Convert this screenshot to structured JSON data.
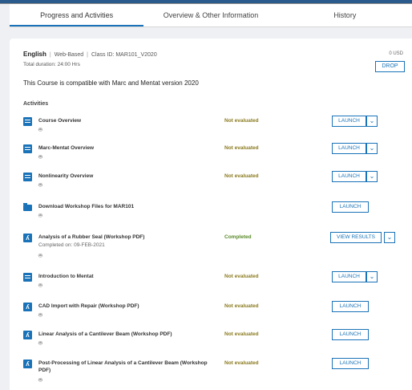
{
  "tabs": [
    {
      "label": "Progress and Activities",
      "active": true
    },
    {
      "label": "Overview & Other Information",
      "active": false
    },
    {
      "label": "History",
      "active": false
    }
  ],
  "course": {
    "language": "English",
    "delivery": "Web-Based",
    "class_id": "Class ID: MAR101_V2020",
    "duration": "Total duration: 24:00 Hrs",
    "price": "0 USD",
    "drop_label": "DROP",
    "compatibility": "This Course is compatible with Marc and Mentat version 2020"
  },
  "activities_heading": "Activities",
  "activities": [
    {
      "title": "Course Overview",
      "icon": "document-icon",
      "status": "Not evaluated",
      "button": "LAUNCH",
      "has_dropdown": true
    },
    {
      "title": "Marc-Mentat Overview",
      "icon": "document-icon",
      "status": "Not evaluated",
      "button": "LAUNCH",
      "has_dropdown": true
    },
    {
      "title": "Nonlinearity Overview",
      "icon": "document-icon",
      "status": "Not evaluated",
      "button": "LAUNCH",
      "has_dropdown": true
    },
    {
      "title": "Download Workshop Files for MAR101",
      "icon": "folder-icon",
      "status": "",
      "button": "LAUNCH",
      "has_dropdown": false
    },
    {
      "title": "Analysis of a Rubber Seal (Workshop PDF)",
      "icon": "pdf-icon",
      "status": "Completed",
      "completed_on": "Completed on: 09-FEB-2021",
      "button": "VIEW RESULTS",
      "has_dropdown": true
    },
    {
      "title": "Introduction to Mentat",
      "icon": "document-icon",
      "status": "Not evaluated",
      "button": "LAUNCH",
      "has_dropdown": true
    },
    {
      "title": "CAD Import with Repair (Workshop PDF)",
      "icon": "pdf-icon",
      "status": "Not evaluated",
      "button": "LAUNCH",
      "has_dropdown": false
    },
    {
      "title": "Linear Analysis of a Cantilever Beam (Workshop PDF)",
      "icon": "pdf-icon",
      "status": "Not evaluated",
      "button": "LAUNCH",
      "has_dropdown": false
    },
    {
      "title_line1": "Post-Processing of Linear Analysis of a Cantilever Beam (Workshop",
      "title_line2": "PDF)",
      "icon": "pdf-icon",
      "status": "Not evaluated",
      "button": "LAUNCH",
      "has_dropdown": false
    }
  ],
  "platform_icons": [
    "android-icon",
    "apple-icon"
  ],
  "colors": {
    "accent": "#1a73b8",
    "not_evaluated": "#8a7a1e",
    "completed": "#5a8a2a"
  }
}
